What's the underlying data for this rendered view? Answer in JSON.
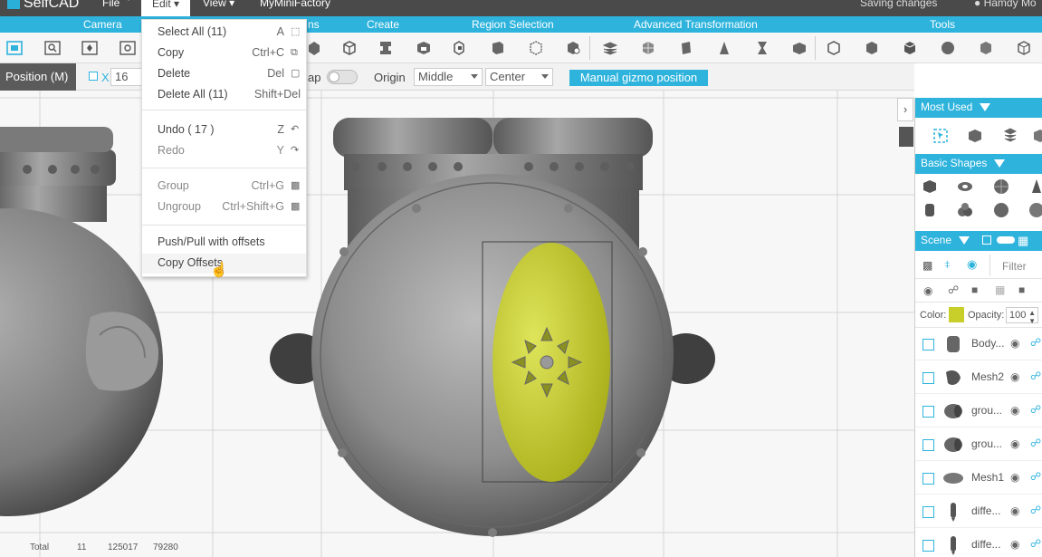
{
  "app": {
    "logo": "SelfCAD"
  },
  "topmenu": {
    "file": "File",
    "edit": "Edit",
    "view": "View",
    "mmf": "MyMiniFactory",
    "saving": "Saving changes",
    "user": "Hamdy Mo"
  },
  "categories": [
    "Camera",
    "Create",
    "Region Selection",
    "Advanced Transformation",
    "Tools"
  ],
  "category_partial": "ns",
  "propbar": {
    "mode": "Position (M)",
    "x_label": "X",
    "x_value": "16",
    "snap_label": "ap",
    "origin_label": "Origin",
    "origin_value": "Middle",
    "align_value": "Center",
    "gizmo_button": "Manual gizmo position"
  },
  "edit_menu": [
    {
      "label": "Select All (11)",
      "shortcut": "A",
      "icon": "select-all-icon"
    },
    {
      "label": "Copy",
      "shortcut": "Ctrl+C",
      "icon": "copy-icon"
    },
    {
      "label": "Delete",
      "shortcut": "Del",
      "icon": "trash-icon"
    },
    {
      "label": "Delete All (11)",
      "shortcut": "Shift+Del"
    },
    {
      "label": "Undo ( 17 )",
      "shortcut": "Z",
      "icon": "undo-icon"
    },
    {
      "label": "Redo",
      "shortcut": "Y",
      "icon": "redo-icon"
    },
    {
      "label": "Group",
      "shortcut": "Ctrl+G",
      "icon": "group-icon"
    },
    {
      "label": "Ungroup",
      "shortcut": "Ctrl+Shift+G",
      "icon": "ungroup-icon"
    },
    {
      "label": "Push/Pull with offsets"
    },
    {
      "label": "Copy Offsets"
    }
  ],
  "panels": {
    "most_used": "Most Used",
    "basic_shapes": "Basic Shapes",
    "scene": "Scene",
    "filter": "Filter",
    "color_label": "Color:",
    "color_value": "#c8cf2a",
    "opacity_label": "Opacity:",
    "opacity_value": "100"
  },
  "scene_items": [
    {
      "name": "Body..."
    },
    {
      "name": "Mesh2"
    },
    {
      "name": "grou..."
    },
    {
      "name": "grou..."
    },
    {
      "name": "Mesh1"
    },
    {
      "name": "diffe..."
    },
    {
      "name": "diffe..."
    }
  ],
  "stats": {
    "label": "Total",
    "v1": "11",
    "v2": "125017",
    "v3": "79280"
  },
  "colors": {
    "accent": "#2eb3dd",
    "selection": "#c8cf2a"
  }
}
